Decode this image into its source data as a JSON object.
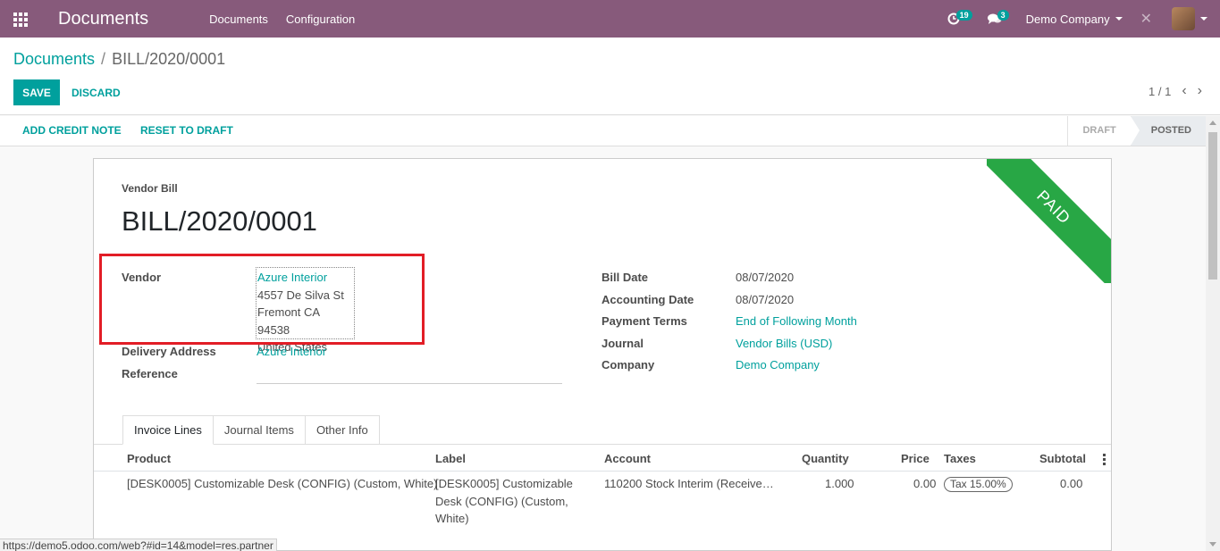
{
  "navbar": {
    "brand": "Documents",
    "menu": [
      "Documents",
      "Configuration"
    ],
    "activity_count": "19",
    "message_count": "3",
    "company": "Demo Company"
  },
  "breadcrumb": {
    "parent": "Documents",
    "separator": "/",
    "current": "BILL/2020/0001"
  },
  "buttons": {
    "save": "SAVE",
    "discard": "DISCARD"
  },
  "pager": {
    "value": "1 / 1"
  },
  "statusbar": {
    "add_credit_note": "ADD CREDIT NOTE",
    "reset_to_draft": "RESET TO DRAFT",
    "stages": [
      "DRAFT",
      "POSTED"
    ]
  },
  "form": {
    "ribbon": "PAID",
    "doc_type": "Vendor Bill",
    "doc_name": "BILL/2020/0001",
    "vendor_label": "Vendor",
    "vendor_name": "Azure Interior",
    "vendor_address": [
      "4557 De Silva St",
      "Fremont CA 94538",
      "United States"
    ],
    "delivery_label": "Delivery Address",
    "delivery_value": "Azure Interior",
    "reference_label": "Reference",
    "right_fields": [
      {
        "label": "Bill Date",
        "value": "08/07/2020"
      },
      {
        "label": "Accounting Date",
        "value": "08/07/2020"
      },
      {
        "label": "Payment Terms",
        "value": "End of Following Month"
      },
      {
        "label": "Journal",
        "value": "Vendor Bills (USD)"
      },
      {
        "label": "Company",
        "value": "Demo Company"
      }
    ]
  },
  "tabs": [
    "Invoice Lines",
    "Journal Items",
    "Other Info"
  ],
  "table": {
    "columns": [
      "Product",
      "Label",
      "Account",
      "Quantity",
      "Price",
      "Taxes",
      "Subtotal"
    ],
    "rows": [
      {
        "product": "[DESK0005] Customizable Desk (CONFIG) (Custom, White)",
        "label_lines": [
          "[DESK0005] Customizable",
          "Desk (CONFIG) (Custom,",
          "White)"
        ],
        "account": "110200 Stock Interim (Receive…",
        "quantity": "1.000",
        "price": "0.00",
        "tax": "Tax 15.00%",
        "subtotal": "0.00"
      }
    ]
  },
  "status_url": "https://demo5.odoo.com/web?#id=14&model=res.partner"
}
